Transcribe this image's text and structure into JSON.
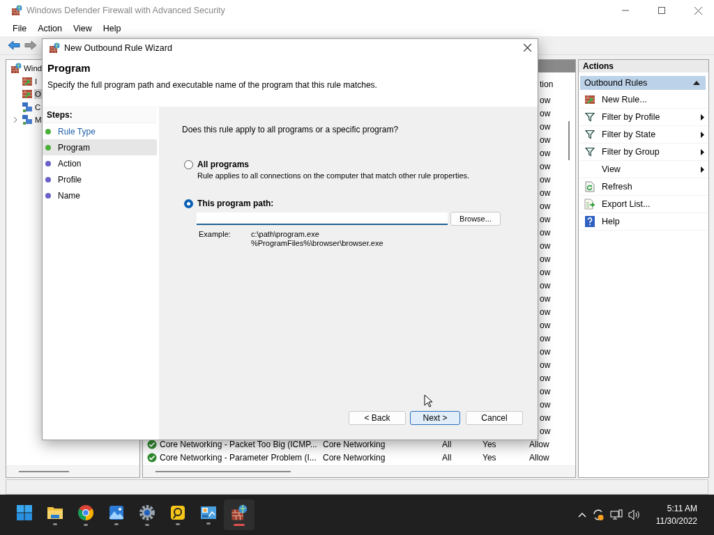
{
  "window": {
    "title": "Windows Defender Firewall with Advanced Security"
  },
  "menu": [
    "File",
    "Action",
    "View",
    "Help"
  ],
  "tree": {
    "items": [
      {
        "label": "Wind",
        "kind": "root",
        "selected": false,
        "children": [
          {
            "label": "I",
            "kind": "rules",
            "selected": false
          },
          {
            "label": "O",
            "kind": "rules",
            "selected": true
          },
          {
            "label": "C",
            "kind": "security",
            "selected": false
          },
          {
            "label": "M",
            "kind": "monitor",
            "selected": false,
            "expanded": false
          }
        ]
      }
    ]
  },
  "rules": {
    "column_fragment": "tion",
    "partial_rows": [
      "ow",
      "ow",
      "ow",
      "ow",
      "ow",
      "ow",
      "ow",
      "ow",
      "ow",
      "ow",
      "ow",
      "ow",
      "ow",
      "ow",
      "ow",
      "ow",
      "ow",
      "ow",
      "ow",
      "ow",
      "ow",
      "ow",
      "ow",
      "ow",
      "ow",
      "ow"
    ],
    "rows": [
      {
        "name": "Core Networking - Packet Too Big (ICMP...",
        "group": "Core Networking",
        "profile": "All",
        "enabled": "Yes",
        "action": "Allow"
      },
      {
        "name": "Core Networking - Parameter Problem (I...",
        "group": "Core Networking",
        "profile": "All",
        "enabled": "Yes",
        "action": "Allow"
      }
    ]
  },
  "actions": {
    "title": "Actions",
    "section": {
      "label": "Outbound Rules",
      "expanded": true
    },
    "items": [
      {
        "label": "New Rule...",
        "kind": "new-rule",
        "submenu": false
      },
      {
        "label": "Filter by Profile",
        "kind": "filter",
        "submenu": true
      },
      {
        "label": "Filter by State",
        "kind": "filter",
        "submenu": true
      },
      {
        "label": "Filter by Group",
        "kind": "filter",
        "submenu": true
      },
      {
        "label": "View",
        "kind": "plain",
        "submenu": true
      },
      {
        "label": "Refresh",
        "kind": "refresh",
        "submenu": false
      },
      {
        "label": "Export List...",
        "kind": "export",
        "submenu": false
      },
      {
        "label": "Help",
        "kind": "help",
        "submenu": false
      }
    ]
  },
  "dialog": {
    "title": "New Outbound Rule Wizard",
    "heading": "Program",
    "description": "Specify the full program path and executable name of the program that this rule matches.",
    "steps_title": "Steps:",
    "steps": [
      {
        "label": "Rule Type",
        "color": "#4caf3a",
        "selected": false,
        "link": true
      },
      {
        "label": "Program",
        "color": "#4caf3a",
        "selected": true,
        "link": false
      },
      {
        "label": "Action",
        "color": "#6a5fc8",
        "selected": false,
        "link": false
      },
      {
        "label": "Profile",
        "color": "#6a5fc8",
        "selected": false,
        "link": false
      },
      {
        "label": "Name",
        "color": "#6a5fc8",
        "selected": false,
        "link": false
      }
    ],
    "question": "Does this rule apply to all programs or a specific program?",
    "options": [
      {
        "label": "All programs",
        "description": "Rule applies to all connections on the computer that match other rule properties.",
        "selected": false,
        "kind": "plain"
      },
      {
        "label": "This program path:",
        "selected": true,
        "kind": "path"
      }
    ],
    "browse_button": "Browse...",
    "example_label": "Example:",
    "examples": [
      "c:\\path\\program.exe",
      "%ProgramFiles%\\browser\\browser.exe"
    ],
    "buttons": [
      {
        "label": "< Back",
        "default": false
      },
      {
        "label": "Next >",
        "default": true
      },
      {
        "label": "Cancel",
        "default": false
      }
    ]
  },
  "taskbar": {
    "apps": [
      {
        "kind": "start",
        "running": false,
        "active": false
      },
      {
        "kind": "folder",
        "running": true,
        "active": false
      },
      {
        "kind": "ring",
        "running": true,
        "active": false
      },
      {
        "kind": "photos",
        "running": true,
        "active": false
      },
      {
        "kind": "gear",
        "running": true,
        "active": false
      },
      {
        "kind": "circular",
        "running": true,
        "active": false
      },
      {
        "kind": "dashboard",
        "running": true,
        "active": false
      },
      {
        "kind": "firewall",
        "running": true,
        "active": true
      }
    ],
    "time": "5:11 AM",
    "date": "11/30/2022"
  }
}
